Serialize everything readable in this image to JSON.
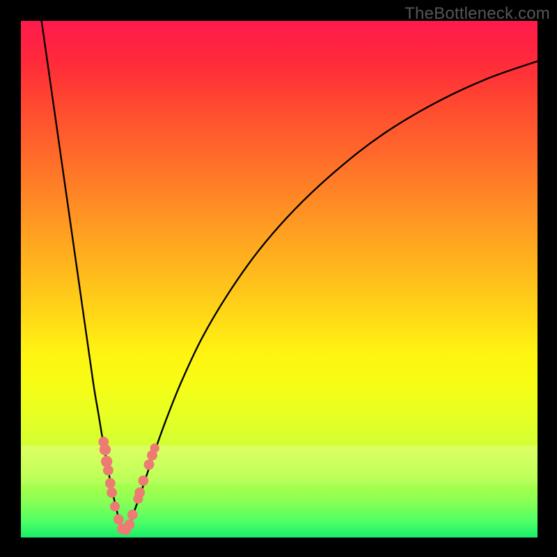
{
  "watermark": "TheBottleneck.com",
  "colors": {
    "frame": "#000000",
    "curve": "#000000",
    "marker": "#ed7b74",
    "gradient_top": "#ff1a4d",
    "gradient_bottom": "#1aed6a"
  },
  "chart_data": {
    "type": "line",
    "title": "",
    "xlabel": "",
    "ylabel": "",
    "xlim": [
      0,
      100
    ],
    "ylim": [
      0,
      100
    ],
    "grid": false,
    "legend": false,
    "note": "x and y are percentages of the plot area; y measured from top (0=top, 100=bottom). Two curves share a minimum near x≈19 at the bottom green band.",
    "series": [
      {
        "name": "left-branch",
        "x": [
          4.0,
          6.0,
          8.0,
          10.0,
          12.0,
          14.0,
          15.0,
          16.0,
          17.0,
          17.8,
          18.5,
          19.0,
          19.4,
          19.8,
          20.2
        ],
        "y": [
          0.0,
          14.0,
          28.0,
          42.0,
          56.0,
          70.0,
          76.0,
          82.0,
          87.5,
          91.5,
          94.5,
          96.7,
          98.0,
          98.8,
          99.3
        ]
      },
      {
        "name": "right-branch",
        "x": [
          20.2,
          21.0,
          22.0,
          23.5,
          25.5,
          28.0,
          31.0,
          35.0,
          40.0,
          46.0,
          53.0,
          61.0,
          70.0,
          80.0,
          90.0,
          100.0
        ],
        "y": [
          99.3,
          97.8,
          94.8,
          90.5,
          84.5,
          77.5,
          70.0,
          61.5,
          53.0,
          44.5,
          36.5,
          29.0,
          22.0,
          16.0,
          11.3,
          7.8
        ]
      }
    ],
    "markers": {
      "name": "highlighted-points",
      "points": [
        {
          "x": 16.0,
          "y": 81.5,
          "r": 1.0
        },
        {
          "x": 16.3,
          "y": 83.0,
          "r": 1.1
        },
        {
          "x": 16.6,
          "y": 85.3,
          "r": 1.1
        },
        {
          "x": 16.9,
          "y": 87.0,
          "r": 1.0
        },
        {
          "x": 17.3,
          "y": 89.5,
          "r": 1.0
        },
        {
          "x": 17.6,
          "y": 91.3,
          "r": 1.0
        },
        {
          "x": 18.2,
          "y": 94.0,
          "r": 0.95
        },
        {
          "x": 18.9,
          "y": 96.5,
          "r": 1.0
        },
        {
          "x": 19.6,
          "y": 98.3,
          "r": 1.0
        },
        {
          "x": 20.3,
          "y": 98.5,
          "r": 1.0
        },
        {
          "x": 21.0,
          "y": 97.5,
          "r": 1.0
        },
        {
          "x": 21.6,
          "y": 95.6,
          "r": 1.0
        },
        {
          "x": 22.7,
          "y": 92.5,
          "r": 0.95
        },
        {
          "x": 23.0,
          "y": 91.3,
          "r": 1.0
        },
        {
          "x": 23.7,
          "y": 89.0,
          "r": 1.0
        },
        {
          "x": 24.8,
          "y": 85.9,
          "r": 1.0
        },
        {
          "x": 25.4,
          "y": 84.1,
          "r": 1.0
        },
        {
          "x": 25.9,
          "y": 82.7,
          "r": 0.9
        }
      ]
    }
  }
}
